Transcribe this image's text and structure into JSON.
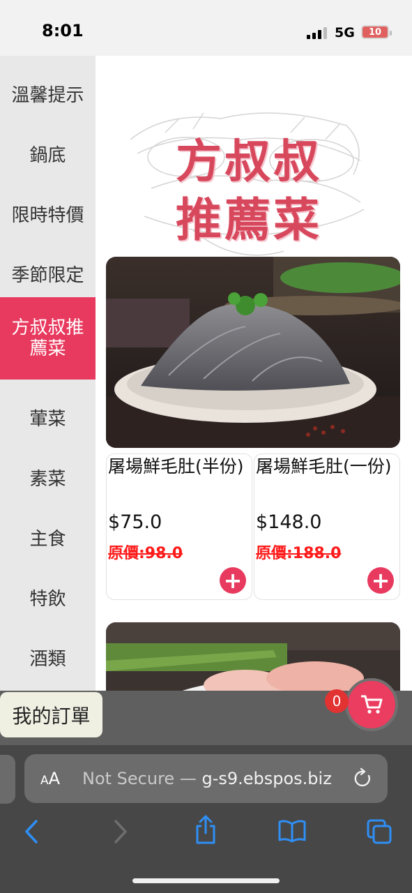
{
  "status_bar": {
    "time": "8:01",
    "network": "5G",
    "battery": "10"
  },
  "sidebar": {
    "items": [
      {
        "label": "溫馨提示"
      },
      {
        "label": "鍋底"
      },
      {
        "label": "限時特價"
      },
      {
        "label": "季節限定"
      },
      {
        "label": "方叔叔推薦菜",
        "active": true
      },
      {
        "label": "葷菜"
      },
      {
        "label": "素菜"
      },
      {
        "label": "主食"
      },
      {
        "label": "特飲"
      },
      {
        "label": "酒類"
      }
    ]
  },
  "banner": {
    "line1": "方叔叔",
    "line2": "推薦菜"
  },
  "products": [
    {
      "name": "屠場鮮毛肚(半份)",
      "price": "$75.0",
      "original_price": "原價:98.0"
    },
    {
      "name": "屠場鮮毛肚(一份)",
      "price": "$148.0",
      "original_price": "原價:188.0"
    }
  ],
  "order_bar": {
    "my_order_label": "我的訂單",
    "cart_count": "0"
  },
  "browser": {
    "aa_label_small": "A",
    "aa_label_large": "A",
    "url_prefix": "Not Secure — ",
    "url_domain": "g-s9.ebspos.biz"
  },
  "colors": {
    "accent": "#e8395e",
    "discount": "#ff1a1a",
    "ios_blue": "#2f8ff5"
  },
  "icons": [
    "plus-icon",
    "shopping-cart-icon",
    "reload-icon",
    "back-icon",
    "forward-icon",
    "share-icon",
    "bookmarks-icon",
    "tabs-icon"
  ]
}
